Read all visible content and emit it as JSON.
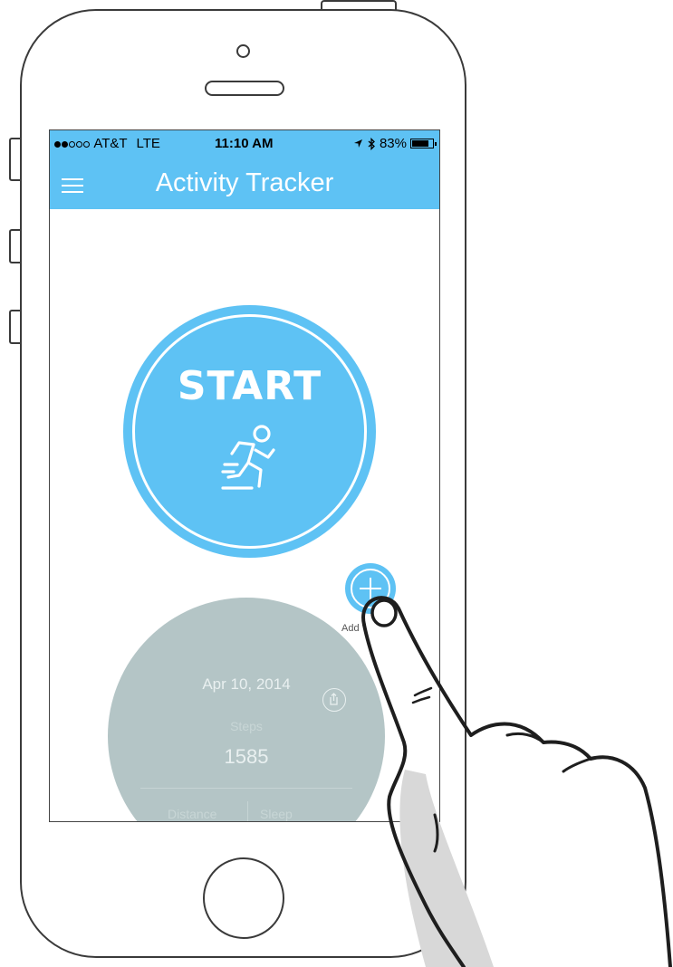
{
  "status_bar": {
    "carrier": "AT&T",
    "network": "LTE",
    "time": "11:10 AM",
    "battery": "83%",
    "signal_bars": 2,
    "signal_total": 5
  },
  "header": {
    "title": "Activity Tracker",
    "menu_icon": "hamburger-menu-icon"
  },
  "start_button": {
    "label": "START",
    "icon": "running-person-icon"
  },
  "add_button": {
    "label": "Add",
    "icon": "plus-icon"
  },
  "summary": {
    "date": "Apr 10, 2014",
    "steps_label": "Steps",
    "steps_value": "1585",
    "distance_label": "Distance",
    "sleep_label": "Sleep",
    "share_icon": "share-icon"
  },
  "colors": {
    "accent": "#5ec2f4",
    "summary_bg": "#b4c5c6",
    "phone_outline": "#3a3a3a"
  }
}
